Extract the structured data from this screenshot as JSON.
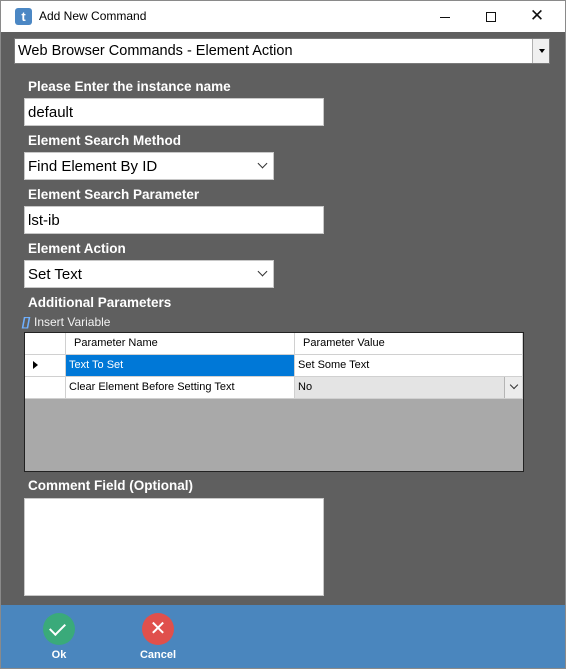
{
  "window": {
    "title": "Add New Command",
    "icon_letter": "t",
    "minimize_glyph": "",
    "close_glyph": "✕"
  },
  "command_selector": {
    "value": "Web Browser Commands - Element Action"
  },
  "form": {
    "instance_label": "Please Enter the instance name",
    "instance_value": "default",
    "search_method_label": "Element Search Method",
    "search_method_value": "Find Element By ID",
    "search_param_label": "Element Search Parameter",
    "search_param_value": "lst-ib",
    "action_label": "Element Action",
    "action_value": "Set Text",
    "additional_label": "Additional Parameters",
    "insert_variable_icon": "[]",
    "insert_variable_label": "Insert Variable",
    "comment_label": "Comment Field (Optional)",
    "comment_value": ""
  },
  "grid": {
    "headers": [
      "Parameter Name",
      "Parameter Value"
    ],
    "rows": [
      {
        "name": "Text To Set",
        "value": "Set Some Text",
        "selected": true
      },
      {
        "name": "Clear Element Before Setting Text",
        "value": "No",
        "selected": false
      }
    ]
  },
  "footer": {
    "ok_label": "Ok",
    "cancel_label": "Cancel",
    "cancel_glyph": "✕"
  },
  "colors": {
    "panel_bg": "#5f5f5f",
    "footer_bg": "#4a86be",
    "ok": "#3aaa7a",
    "cancel": "#e0504c",
    "selection": "#0078d7"
  }
}
